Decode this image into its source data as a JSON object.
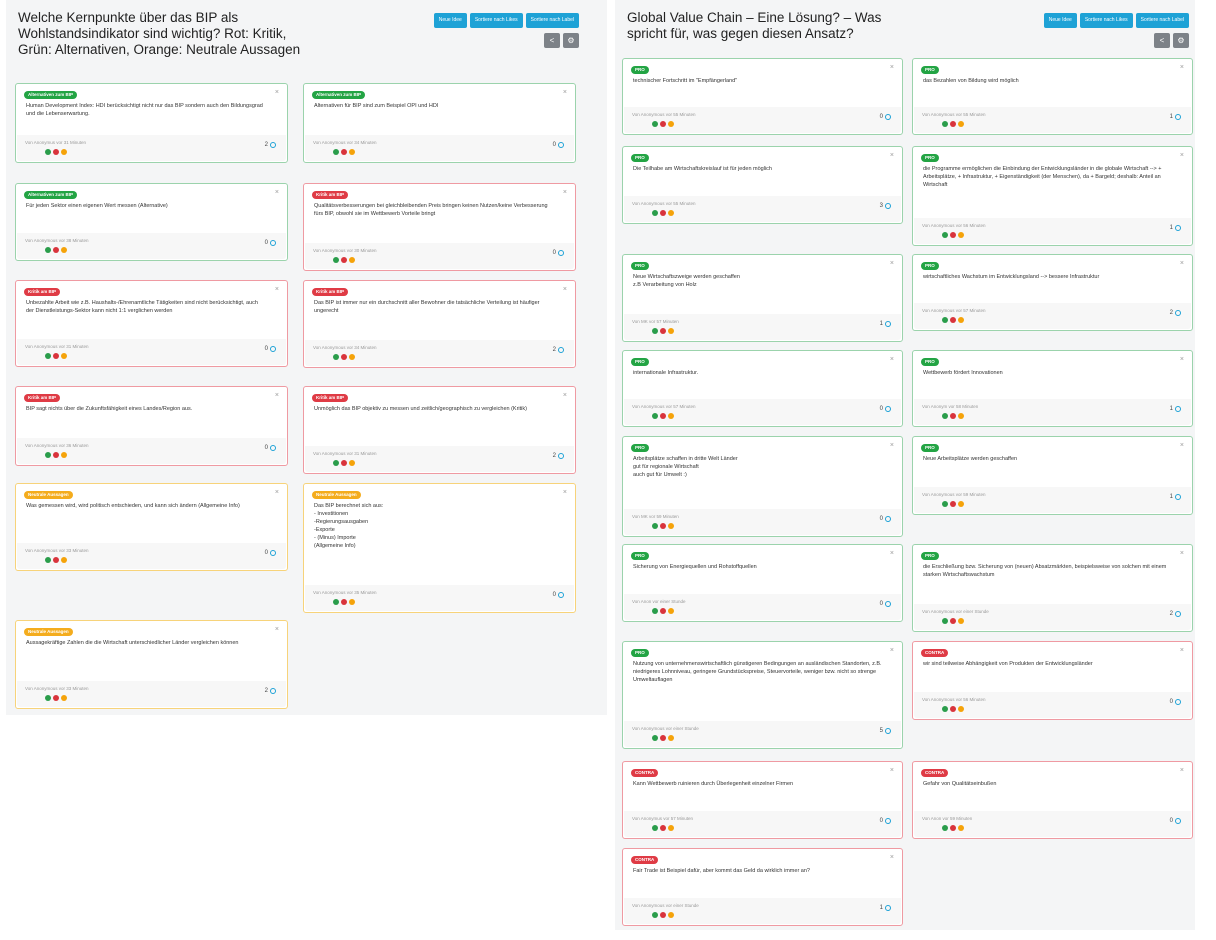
{
  "left": {
    "title": "Welche Kernpunkte über das BIP als Wohlstandsindikator sind wichtig? Rot: Kritik, Grün: Alternativen, Orange: Neutrale Aussagen",
    "buttons": [
      "Neue Idee",
      "Sortiere nach Likes",
      "Sortiere nach Label"
    ],
    "cards": [
      {
        "badge": "Alternativen zum BIP",
        "color": "green",
        "text": "Human Development Index: HDI berücksichtigt nicht nur das BIP sondern auch den Bildungsgrad und die Lebenserwartung.",
        "author": "Von Anonymus vor 31 Minuten",
        "votes": "2"
      },
      {
        "badge": "Alternativen zum BIP",
        "color": "green",
        "text": "Alternativen für BIP sind zum Beispiel OPI und HDI",
        "author": "Von Anonymous vor 34 Minuten",
        "votes": "0"
      },
      {
        "badge": "Alternativen zum BIP",
        "color": "green",
        "text": "Für jeden Sektor einen eigenen Wert messen (Alternative)",
        "author": "Von Anonymous vor 38 Minuten",
        "votes": "0"
      },
      {
        "badge": "Kritik am BIP",
        "color": "red",
        "text": "Qualitätsverbesserungen bei gleichbleibenden Preis bringen keinen Nutzen/keine Verbesserung fürs BIP, obwohl sie im Wettbewerb Vorteile bringt",
        "author": "Von Anonymous vor 30 Minuten",
        "votes": "0"
      },
      {
        "badge": "Kritik am BIP",
        "color": "red",
        "text": "Unbezahlte Arbeit wie z.B. Haushalts-/Ehrenamtliche Tätigkeiten sind nicht berücksichtigt, auch der Dienstleistungs-Sektor kann nicht 1:1 verglichen werden",
        "author": "Von Anonymous vor 31 Minuten",
        "votes": "0"
      },
      {
        "badge": "Kritik am BIP",
        "color": "red",
        "text": "Das BIP ist immer nur ein durchschnitt aller Bewohner die tatsächliche Verteilung ist häufiger ungerecht",
        "author": "Von Anonymous vor 34 Minuten",
        "votes": "2"
      },
      {
        "badge": "Kritik am BIP",
        "color": "red",
        "text": "BIP sagt nichts über die Zukunftsfähigkeit eines Landes/Region aus.",
        "author": "Von Anonymous vor 36 Minuten",
        "votes": "0"
      },
      {
        "badge": "Kritik am BIP",
        "color": "red",
        "text": "Unmöglich das BIP objektiv zu messen und zeitlich/geographisch zu vergleichen (Kritik)",
        "author": "Von Anonymous vor 31 Minuten",
        "votes": "2"
      },
      {
        "badge": "Neutrale Aussagen",
        "color": "orange",
        "text": "Was gemessen wird, wird politisch entschieden, und kann sich ändern (Allgemeine Info)",
        "author": "Von Anonymous vor 33 Minuten",
        "votes": "0"
      },
      {
        "badge": "Neutrale Aussagen",
        "color": "orange",
        "text": "Das BIP berechnet sich aus:\n- Investitionen\n-Regierungsausgaben\n-Exporte\n- (Minus) Importe\n(Allgemeine Info)",
        "author": "Von Anonymous vor 35 Minuten",
        "votes": "0"
      },
      {
        "badge": "Neutrale Aussagen",
        "color": "orange",
        "text": "Aussagekräftige Zahlen die die Wirtschaft unterschiedlicher Länder vergleichen können",
        "author": "Von Anonymous vor 33 Minuten",
        "votes": "2"
      }
    ]
  },
  "right": {
    "title": "Global Value Chain – Eine Lösung? – Was spricht für, was gegen diesen Ansatz?",
    "buttons": [
      "Neue Idee",
      "Sortiere nach Likes",
      "Sortiere nach Label"
    ],
    "cards": [
      {
        "badge": "PRO",
        "color": "green",
        "text": "technischer Fortschritt im \"Empfängerland\"",
        "author": "Von Anonymous vor 55 Minuten",
        "votes": "0"
      },
      {
        "badge": "PRO",
        "color": "green",
        "text": "das Bezahlen von Bildung wird möglich",
        "author": "Von Anonymous vor 55 Minuten",
        "votes": "1"
      },
      {
        "badge": "PRO",
        "color": "green",
        "text": "Die Teilhabe am Wirtschaftskreislauf ist für jeden möglich",
        "author": "Von Anonymous vor 55 Minuten",
        "votes": "3"
      },
      {
        "badge": "PRO",
        "color": "green",
        "text": "die Programme ermöglichen die Einbindung der Entwicklungsländer in die globale Wirtschaft --> + Arbeitsplätze, + Infrastruktur, + Eigenständigkeit (der Menschen), da + Bargeld; deshalb: Anteil an Wirtschaft",
        "author": "Von Anonymous vor 56 Minuten",
        "votes": "1"
      },
      {
        "badge": "PRO",
        "color": "green",
        "text": "Neue Wirtschaftszweige werden geschaffen\n z.B Verarbeitung von Holz",
        "author": "Von MK vor 57 Minuten",
        "votes": "1"
      },
      {
        "badge": "PRO",
        "color": "green",
        "text": "wirtschaftliches Wachstum im Entwicklungsland --> bessere Infrastruktur",
        "author": "Von Anonymous vor 57 Minuten",
        "votes": "2"
      },
      {
        "badge": "PRO",
        "color": "green",
        "text": "internationale Infrastruktur.",
        "author": "Von Anonymous vor 57 Minuten",
        "votes": "0"
      },
      {
        "badge": "PRO",
        "color": "green",
        "text": "Wettbewerb fördert Innovationen",
        "author": "Von Anonym vor 58 Minuten",
        "votes": "1"
      },
      {
        "badge": "PRO",
        "color": "green",
        "text": "Arbeitsplätze schaffen in dritte Welt Länder\n gut für regionale Wirtschaft\n auch gut für Umwelt :)",
        "author": "Von MK vor 59 Minuten",
        "votes": "0"
      },
      {
        "badge": "PRO",
        "color": "green",
        "text": "Neue Arbeitsplätze werden geschaffen",
        "author": "Von Anonymous vor 59 Minuten",
        "votes": "1"
      },
      {
        "badge": "PRO",
        "color": "green",
        "text": "Sicherung von Energiequellen und Rohstoffquellen",
        "author": "Von Anon vor einer Stunde",
        "votes": "0"
      },
      {
        "badge": "PRO",
        "color": "green",
        "text": "die Erschließung bzw. Sicherung von (neuen) Absatzmärkten, beispielsweise von solchen mit einem starken Wirtschaftswachstum",
        "author": "Von Anonymous vor einer Stunde",
        "votes": "2"
      },
      {
        "badge": "PRO",
        "color": "green",
        "text": "Nutzung von unternehmenswirtschaftlich günstigeren Bedingungen an ausländischen Standorten, z.B. niedrigeres Lohnniveau, geringere Grundstückspreise, Steuervorteile, weniger bzw. nicht so strenge Umweltauflagen",
        "author": "Von Anonymous vor einer Stunde",
        "votes": "5"
      },
      {
        "badge": "CONTRA",
        "color": "red",
        "text": "wir sind teilweise Abhängigkeit von Produkten der Entwicklungsländer",
        "author": "Von Anonymous vor 56 Minuten",
        "votes": "0"
      },
      {
        "badge": "CONTRA",
        "color": "red",
        "text": "Kann Wettbewerb ruinieren durch Überlegenheit einzelner Firmen",
        "author": "Von Anonymus vor 57 Minuten",
        "votes": "0"
      },
      {
        "badge": "CONTRA",
        "color": "red",
        "text": "Gefahr von Qualitätseinbußen",
        "author": "Von Anon vor 59 Minuten",
        "votes": "0"
      },
      {
        "badge": "CONTRA",
        "color": "red",
        "text": "Fair Trade ist Beispiel dafür, aber kommt das Geld da wirklich immer an?",
        "author": "Von Anonymous vor einer Stunde",
        "votes": "1"
      }
    ]
  }
}
